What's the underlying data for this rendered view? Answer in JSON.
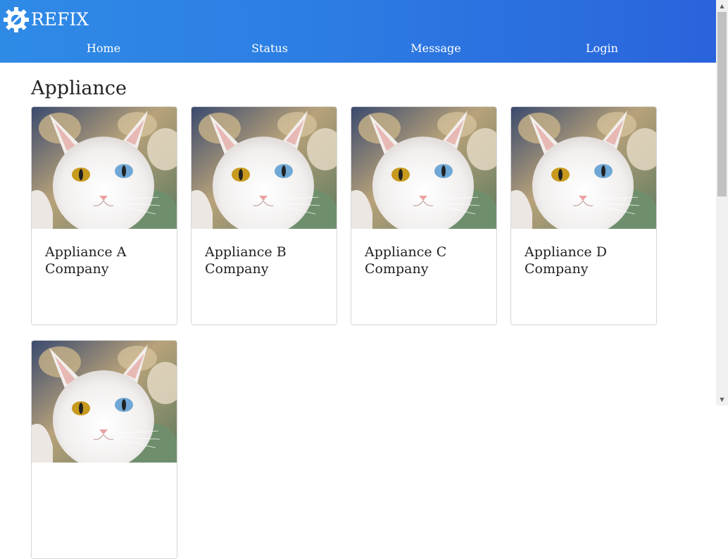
{
  "header": {
    "logo_text": "REFIX",
    "logo_icon": "gear-wrench-icon",
    "colors": {
      "gradient_start": "#2f8ae6",
      "gradient_end": "#2a63dc"
    },
    "nav": [
      {
        "label": "Home"
      },
      {
        "label": "Status"
      },
      {
        "label": "Message"
      },
      {
        "label": "Login"
      }
    ]
  },
  "main": {
    "title": "Appliance",
    "cards": [
      {
        "title": "Appliance A Company",
        "image": "white-cat-photo"
      },
      {
        "title": "Appliance B Company",
        "image": "white-cat-photo"
      },
      {
        "title": "Appliance C Company",
        "image": "white-cat-photo"
      },
      {
        "title": "Appliance D Company",
        "image": "white-cat-photo"
      },
      {
        "title": "",
        "image": "white-cat-photo"
      }
    ]
  }
}
